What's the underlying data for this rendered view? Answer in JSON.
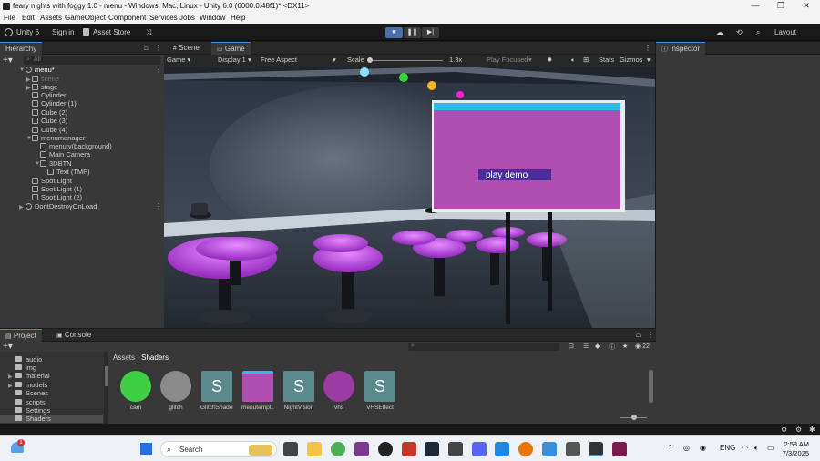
{
  "window": {
    "title": "feary nights with foggy 1.0 - menu - Windows, Mac, Linux - Unity 6.0 (6000.0.48f1)* <DX11>",
    "min": "—",
    "max": "❐",
    "close": "✕"
  },
  "menu": [
    "File",
    "Edit",
    "Assets",
    "GameObject",
    "Component",
    "Services",
    "Jobs",
    "Window",
    "Help"
  ],
  "toolbar": {
    "account": "Unity 6",
    "signin": "Sign in",
    "store": "Asset Store",
    "layout": "Layout"
  },
  "hierarchy": {
    "tab": "Hierarchy",
    "search_placeholder": "All",
    "items": [
      {
        "label": "menu*"
      },
      {
        "label": "scene"
      },
      {
        "label": "stage"
      },
      {
        "label": "Cylinder"
      },
      {
        "label": "Cylinder (1)"
      },
      {
        "label": "Cube (2)"
      },
      {
        "label": "Cube (3)"
      },
      {
        "label": "Cube (4)"
      },
      {
        "label": "menumanager"
      },
      {
        "label": "menutv(background)"
      },
      {
        "label": "Main Camera"
      },
      {
        "label": "3DBTN"
      },
      {
        "label": "Text (TMP)"
      },
      {
        "label": "Spot Light"
      },
      {
        "label": "Spot Light (1)"
      },
      {
        "label": "Spot Light (2)"
      },
      {
        "label": "DontDestroyOnLoad"
      }
    ]
  },
  "view_tabs": {
    "scene": "Scene",
    "game": "Game"
  },
  "gamebar": {
    "mode": "Game",
    "display": "Display 1",
    "aspect": "Free Aspect",
    "scale_label": "Scale",
    "scale_value": "1.3x",
    "play_focused": "Play Focused",
    "stats": "Stats",
    "gizmos": "Gizmos"
  },
  "game": {
    "button_text": "play demo"
  },
  "inspector": {
    "tab": "Inspector"
  },
  "project": {
    "tabs": [
      "Project",
      "Console"
    ],
    "folders": [
      "audio",
      "img",
      "material",
      "models",
      "Scenes",
      "scripts",
      "Settings",
      "Shaders"
    ],
    "breadcrumb": [
      "Assets",
      "Shaders"
    ],
    "count": "22",
    "assets": [
      {
        "name": "cam",
        "color": "#3fcf45"
      },
      {
        "name": "glitch",
        "color": "#8a8a8a"
      },
      {
        "name": "GlitchShader",
        "color": "#shader"
      },
      {
        "name": "menutempl...",
        "color": "#b04fb1"
      },
      {
        "name": "NightVision",
        "color": "#shader"
      },
      {
        "name": "vhs",
        "color": "#9b3ba3"
      },
      {
        "name": "VHSEffect",
        "color": "#shader"
      }
    ]
  },
  "taskbar": {
    "search": "Search",
    "lang": "ENG",
    "time": "2:58 AM",
    "date": "7/3/2025",
    "badge": "1"
  }
}
